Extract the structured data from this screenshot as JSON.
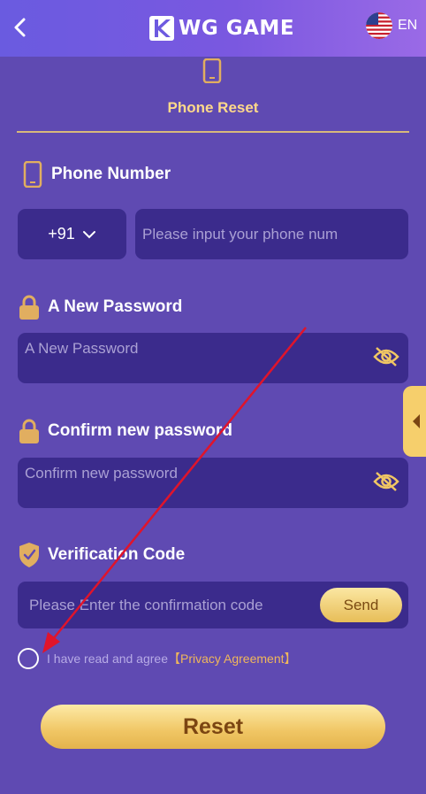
{
  "header": {
    "back_icon": "chevron-left-icon",
    "logo_text": "WG GAME",
    "language": "EN",
    "flag_icon": "us-flag-icon"
  },
  "tab": {
    "icon": "phone-icon",
    "label": "Phone Reset"
  },
  "phone_section": {
    "title": "Phone Number",
    "country_code": "+91",
    "placeholder": "Please input your phone num"
  },
  "new_password_section": {
    "title": "A New Password",
    "placeholder": "A New Password"
  },
  "confirm_password_section": {
    "title": "Confirm new password",
    "placeholder": "Confirm new password"
  },
  "verification_section": {
    "title": "Verification Code",
    "placeholder": "Please Enter the confirmation code",
    "send_label": "Send"
  },
  "agreement": {
    "text": "I have read and agree",
    "link": "【Privacy Agreement】"
  },
  "reset_label": "Reset",
  "colors": {
    "background": "#5f4ab2",
    "field_bg": "#3b2b8c",
    "accent_gold": "#f0c664",
    "tab_label": "#ffd98a",
    "annotation_arrow": "#e0142b"
  }
}
